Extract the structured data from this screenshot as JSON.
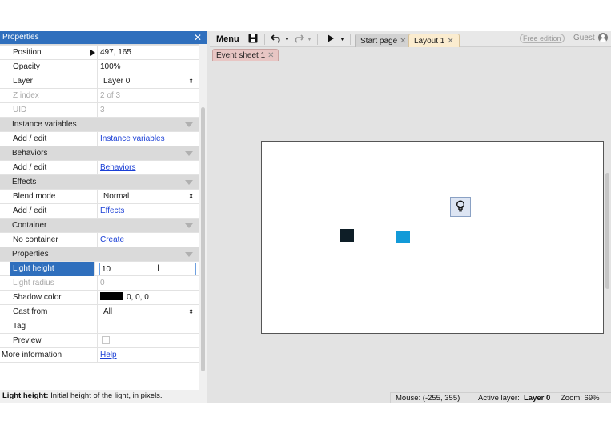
{
  "properties_panel": {
    "title": "Properties",
    "close_glyph": "✕",
    "rows": {
      "position": {
        "label": "Position",
        "value": "497, 165"
      },
      "opacity": {
        "label": "Opacity",
        "value": "100%"
      },
      "layer": {
        "label": "Layer",
        "value": "Layer 0"
      },
      "z_index": {
        "label": "Z index",
        "value": "2 of 3"
      },
      "uid": {
        "label": "UID",
        "value": "3"
      },
      "cat_instance_vars": "Instance variables",
      "instance_vars_add": {
        "label": "Add / edit",
        "value": "Instance variables"
      },
      "cat_behaviors": "Behaviors",
      "behaviors_add": {
        "label": "Add / edit",
        "value": "Behaviors"
      },
      "cat_effects": "Effects",
      "blend_mode": {
        "label": "Blend mode",
        "value": "Normal"
      },
      "effects_add": {
        "label": "Add / edit",
        "value": "Effects"
      },
      "cat_container": "Container",
      "container": {
        "label": "No container",
        "value": "Create"
      },
      "cat_properties": "Properties",
      "light_height": {
        "label": "Light height",
        "value": "10"
      },
      "light_radius": {
        "label": "Light radius",
        "value": "0"
      },
      "shadow_color": {
        "label": "Shadow color",
        "value": "0, 0, 0",
        "swatch": "#000000"
      },
      "cast_from": {
        "label": "Cast from",
        "value": "All"
      },
      "tag": {
        "label": "Tag",
        "value": ""
      },
      "preview": {
        "label": "Preview",
        "checked": false
      },
      "more_info": {
        "label": "More information",
        "value": "Help"
      }
    },
    "description": {
      "term": "Light height:",
      "text": " Initial height of the light, in pixels."
    }
  },
  "toolbar": {
    "menu_label": "Menu",
    "tabs": [
      {
        "label": "Start page",
        "active": false
      },
      {
        "label": "Layout 1",
        "active": true
      }
    ],
    "close_glyph": "✕",
    "edition_badge": "Free edition",
    "user_label": "Guest"
  },
  "subtabs": {
    "event_sheet": "Event sheet 1"
  },
  "status_bar": {
    "mouse": "Mouse: (-255, 355)",
    "active_layer_label": "Active layer:",
    "active_layer_value": "Layer 0",
    "zoom": "Zoom: 69%"
  },
  "colors": {
    "accent": "#2f6fbd",
    "sprite_dark": "#0e1e27",
    "sprite_blue": "#129ad8",
    "event_tab": "#e8c6c4",
    "layout_tab": "#fbeccf"
  },
  "icons": [
    "close-icon",
    "save-icon",
    "undo-icon",
    "redo-icon",
    "play-icon",
    "dropdown-icon",
    "user-icon",
    "lightbulb-icon",
    "expand-arrow-icon",
    "text-cursor-icon"
  ]
}
